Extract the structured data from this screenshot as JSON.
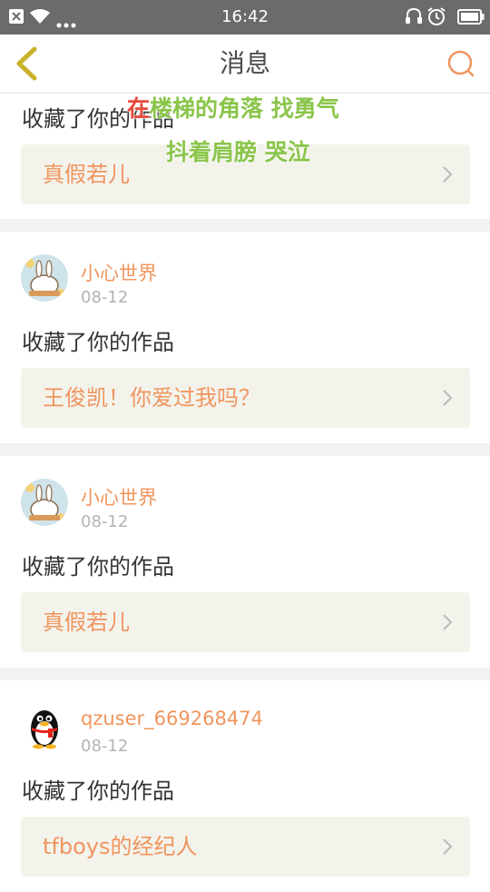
{
  "status_bar": {
    "time": "16:42"
  },
  "header": {
    "title": "消息"
  },
  "overlay": {
    "line1_highlight": "在",
    "line1_rest": "楼梯的角落 找勇气",
    "line2": "抖着肩膀 哭泣"
  },
  "notifications": [
    {
      "action": "收藏了你的作品",
      "work_title": "真假若儿"
    },
    {
      "username": "小心世界",
      "date": "08-12",
      "action": "收藏了你的作品",
      "work_title": "王俊凯！你爱过我吗？",
      "avatar": "cartoon-avatar"
    },
    {
      "username": "小心世界",
      "date": "08-12",
      "action": "收藏了你的作品",
      "work_title": "真假若儿",
      "avatar": "cartoon-avatar"
    },
    {
      "username": "qzuser_669268474",
      "date": "08-12",
      "action": "收藏了你的作品",
      "work_title": "tfboys的经纪人",
      "avatar": "penguin-avatar"
    }
  ],
  "colors": {
    "accent": "#f0955e",
    "status_bar": "#6b6b6b",
    "work_box": "#f3f3ec",
    "lyric_green": "#8ac54a",
    "lyric_red": "#e84a3c"
  }
}
